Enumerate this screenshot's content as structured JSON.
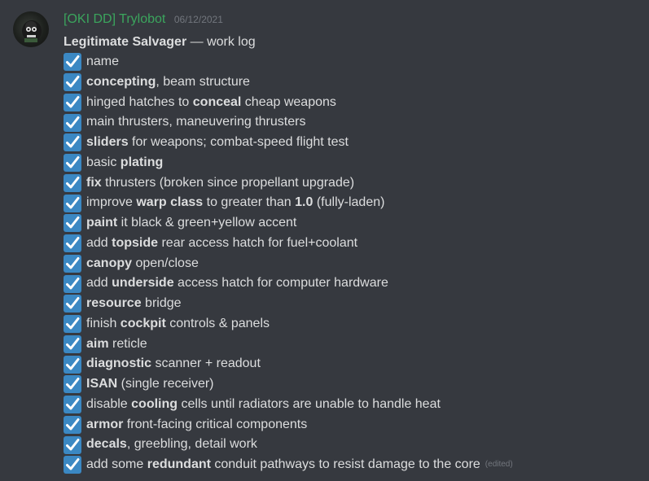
{
  "message": {
    "username": "[OKI DD] Trylobot",
    "timestamp": "06/12/2021",
    "title_bold": "Legitimate Salvager",
    "title_rest": " — work log",
    "edited_label": "(edited)",
    "check_icon": "white-heavy-check-mark-icon",
    "accent_color": "#3b88c3",
    "username_color": "#3ba55d",
    "items": [
      [
        {
          "t": "name",
          "b": false
        }
      ],
      [
        {
          "t": "concepting",
          "b": true
        },
        {
          "t": ", beam structure",
          "b": false
        }
      ],
      [
        {
          "t": "hinged hatches to ",
          "b": false
        },
        {
          "t": "conceal",
          "b": true
        },
        {
          "t": " cheap weapons",
          "b": false
        }
      ],
      [
        {
          "t": "main thrusters, maneuvering thrusters",
          "b": false
        }
      ],
      [
        {
          "t": "sliders",
          "b": true
        },
        {
          "t": " for weapons; combat-speed flight test",
          "b": false
        }
      ],
      [
        {
          "t": "basic ",
          "b": false
        },
        {
          "t": "plating",
          "b": true
        }
      ],
      [
        {
          "t": "fix",
          "b": true
        },
        {
          "t": " thrusters (broken since propellant upgrade)",
          "b": false
        }
      ],
      [
        {
          "t": "improve ",
          "b": false
        },
        {
          "t": "warp class",
          "b": true
        },
        {
          "t": " to greater than ",
          "b": false
        },
        {
          "t": "1.0",
          "b": true
        },
        {
          "t": " (fully-laden)",
          "b": false
        }
      ],
      [
        {
          "t": "paint",
          "b": true
        },
        {
          "t": " it black & green+yellow accent",
          "b": false
        }
      ],
      [
        {
          "t": "add ",
          "b": false
        },
        {
          "t": "topside",
          "b": true
        },
        {
          "t": " rear access hatch for fuel+coolant",
          "b": false
        }
      ],
      [
        {
          "t": "canopy",
          "b": true
        },
        {
          "t": " open/close",
          "b": false
        }
      ],
      [
        {
          "t": "add ",
          "b": false
        },
        {
          "t": "underside",
          "b": true
        },
        {
          "t": " access hatch for computer hardware",
          "b": false
        }
      ],
      [
        {
          "t": "resource",
          "b": true
        },
        {
          "t": " bridge",
          "b": false
        }
      ],
      [
        {
          "t": "finish ",
          "b": false
        },
        {
          "t": "cockpit",
          "b": true
        },
        {
          "t": " controls & panels",
          "b": false
        }
      ],
      [
        {
          "t": "aim",
          "b": true
        },
        {
          "t": " reticle",
          "b": false
        }
      ],
      [
        {
          "t": "diagnostic",
          "b": true
        },
        {
          "t": " scanner + readout",
          "b": false
        }
      ],
      [
        {
          "t": "ISAN",
          "b": true
        },
        {
          "t": " (single receiver)",
          "b": false
        }
      ],
      [
        {
          "t": "disable ",
          "b": false
        },
        {
          "t": "cooling",
          "b": true
        },
        {
          "t": " cells until radiators are unable to handle heat",
          "b": false
        }
      ],
      [
        {
          "t": "armor",
          "b": true
        },
        {
          "t": " front-facing critical components",
          "b": false
        }
      ],
      [
        {
          "t": "decals",
          "b": true
        },
        {
          "t": ", greebling, detail work",
          "b": false
        }
      ],
      [
        {
          "t": "add some ",
          "b": false
        },
        {
          "t": "redundant",
          "b": true
        },
        {
          "t": " conduit pathways to resist damage to the core",
          "b": false
        }
      ]
    ]
  }
}
